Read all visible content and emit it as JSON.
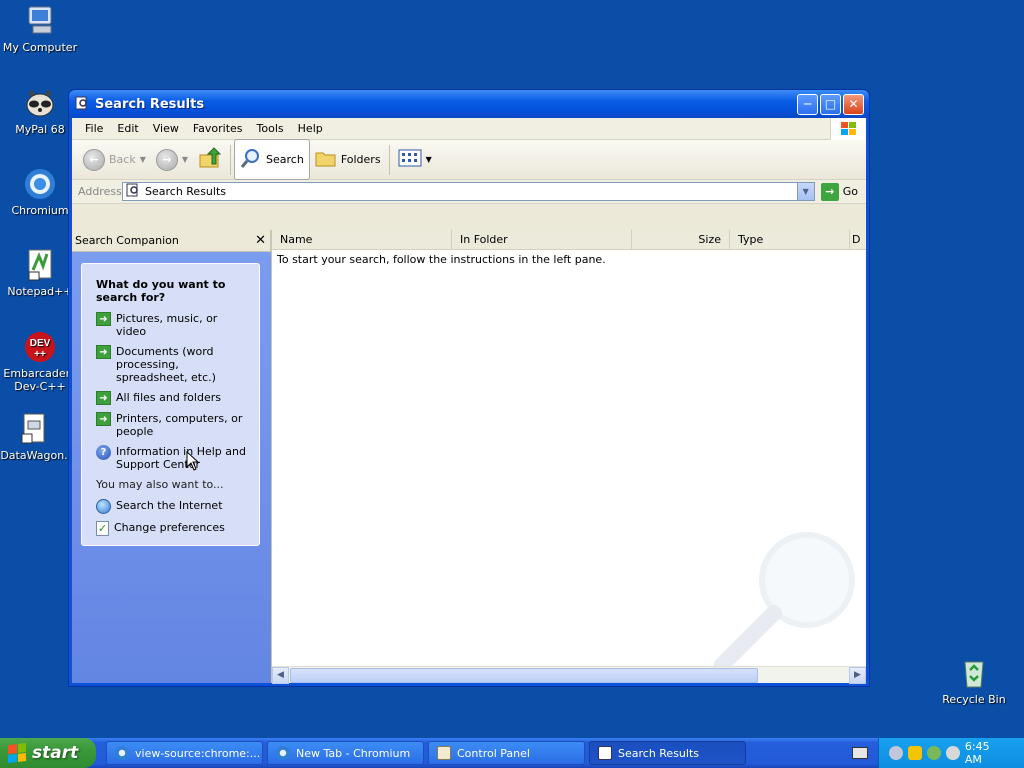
{
  "desktop": {
    "icons": [
      {
        "label": "My Computer"
      },
      {
        "label": "MyPal 68"
      },
      {
        "label": "Chromium"
      },
      {
        "label": "Notepad++"
      },
      {
        "label": "Embarcadero Dev-C++"
      },
      {
        "label": "DataWagon."
      },
      {
        "label": "Recycle Bin"
      }
    ]
  },
  "window": {
    "title": "Search Results",
    "menu": [
      "File",
      "Edit",
      "View",
      "Favorites",
      "Tools",
      "Help"
    ],
    "toolbar": {
      "back": "Back",
      "search": "Search",
      "folders": "Folders"
    },
    "address": {
      "label": "Address",
      "value": "Search Results",
      "go": "Go"
    },
    "left_pane": {
      "header": "Search Companion",
      "question": "What do you want to search for?",
      "options": [
        "Pictures, music, or video",
        "Documents (word processing, spreadsheet, etc.)",
        "All files and folders",
        "Printers, computers, or people",
        "Information in Help and Support Center"
      ],
      "also_label": "You may also want to...",
      "also": [
        "Search the Internet",
        "Change preferences"
      ]
    },
    "columns": [
      "Name",
      "In Folder",
      "Size",
      "Type",
      "D"
    ],
    "message": "To start your search, follow the instructions in the left pane."
  },
  "taskbar": {
    "start": "start",
    "tasks": [
      {
        "label": "view-source:chrome:..."
      },
      {
        "label": "New Tab - Chromium"
      },
      {
        "label": "Control Panel"
      },
      {
        "label": "Search Results"
      }
    ],
    "clock": "6:45 AM"
  }
}
